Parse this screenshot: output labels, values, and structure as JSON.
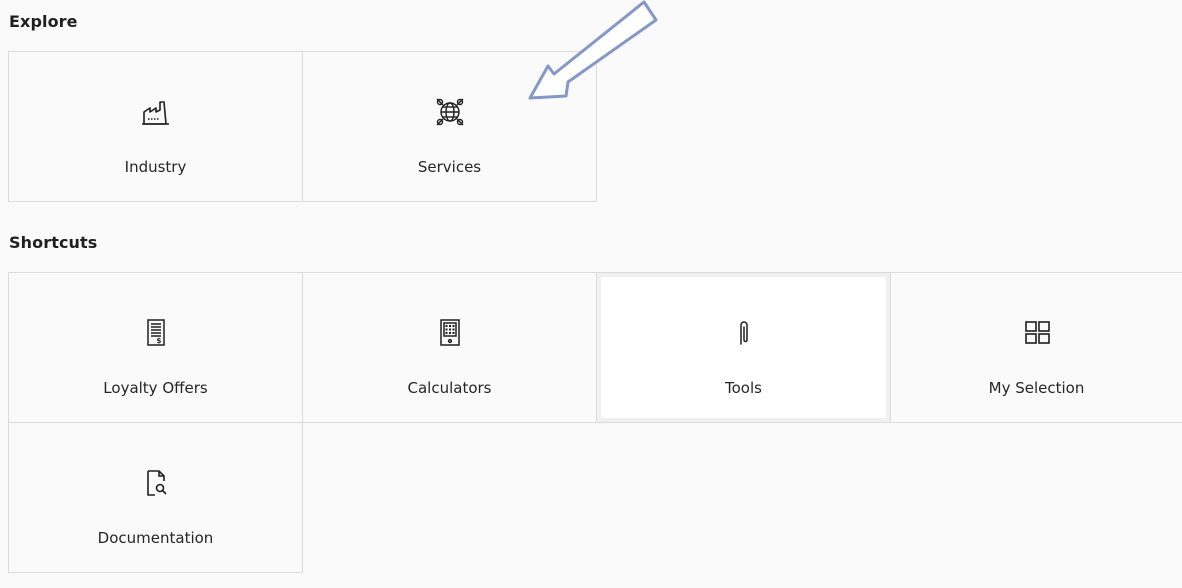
{
  "sections": {
    "explore": {
      "title": "Explore",
      "tiles": [
        {
          "label": "Industry",
          "icon": "factory-icon"
        },
        {
          "label": "Services",
          "icon": "globe-gears-icon"
        }
      ]
    },
    "shortcuts": {
      "title": "Shortcuts",
      "tiles": [
        {
          "label": "Loyalty Offers",
          "icon": "price-list-icon"
        },
        {
          "label": "Calculators",
          "icon": "calculator-icon"
        },
        {
          "label": "Tools",
          "icon": "paperclip-icon"
        },
        {
          "label": "My Selection",
          "icon": "grid-icon"
        },
        {
          "label": "Documentation",
          "icon": "document-search-icon"
        }
      ]
    }
  },
  "annotation": {
    "icon": "arrow-annotation",
    "color": "#8497c7"
  },
  "colors": {
    "background": "#fafafa",
    "border": "#dcdcdc",
    "hover_tile": "#ffffff"
  }
}
